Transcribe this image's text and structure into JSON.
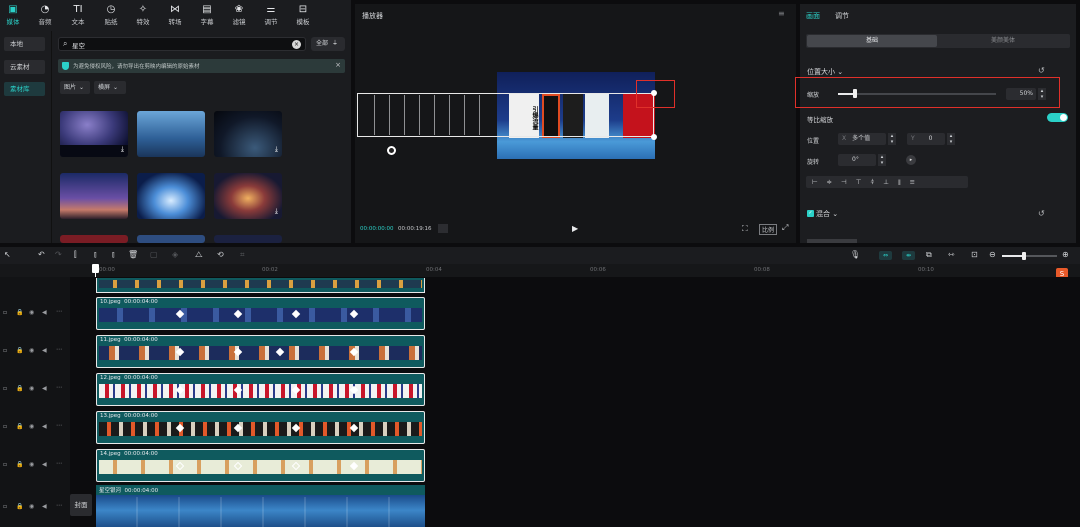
{
  "toolbar": {
    "items": [
      {
        "label": "媒体",
        "icon": "media-icon"
      },
      {
        "label": "音频",
        "icon": "audio-icon"
      },
      {
        "label": "文本",
        "icon": "text-icon"
      },
      {
        "label": "贴纸",
        "icon": "sticker-icon"
      },
      {
        "label": "特效",
        "icon": "effects-icon"
      },
      {
        "label": "转场",
        "icon": "transition-icon"
      },
      {
        "label": "字幕",
        "icon": "subtitle-icon"
      },
      {
        "label": "滤镜",
        "icon": "filter-icon"
      },
      {
        "label": "调节",
        "icon": "adjust-icon"
      },
      {
        "label": "模板",
        "icon": "template-icon"
      }
    ]
  },
  "sidebar": {
    "items": [
      {
        "label": "本地"
      },
      {
        "label": "云素材"
      },
      {
        "label": "素材库"
      }
    ]
  },
  "media": {
    "search_value": "星空",
    "filter_label": "全部",
    "notice": "为避免侵权风险，请勿导出在剪映内编辑的原始素材",
    "type_select": "图片",
    "orientation_select": "横屏"
  },
  "player": {
    "title": "播放器",
    "current_time": "00:00:00:00",
    "total_time": "00:00:19:16",
    "ratio_label": "比例",
    "book_title_1": "引爆流量"
  },
  "inspector": {
    "tabs": [
      "画面",
      "调节"
    ],
    "subtabs": [
      "基础",
      "美颜美体"
    ],
    "position_size_label": "位置大小",
    "scale_label": "缩放",
    "scale_value": "50%",
    "scale_percent": 50,
    "uniform_scale_label": "等比缩放",
    "position_label": "位置",
    "pos_x_label": "X",
    "pos_x_value": "多个值",
    "pos_y_label": "Y",
    "pos_y_value": "0",
    "rotate_label": "旋转",
    "rotate_value": "0°",
    "blend_label": "混合"
  },
  "timeline": {
    "ruler": [
      "00:00",
      "00:02",
      "00:04",
      "00:06",
      "00:08",
      "00:10"
    ],
    "cover_label": "封面",
    "clips": [
      {
        "name": "10.jpeg",
        "duration": "00:00:04:00"
      },
      {
        "name": "11.jpeg",
        "duration": "00:00:04:00"
      },
      {
        "name": "12.jpeg",
        "duration": "00:00:04:00"
      },
      {
        "name": "13.jpeg",
        "duration": "00:00:04:00"
      },
      {
        "name": "14.jpeg",
        "duration": "00:00:04:00"
      }
    ],
    "main_clip": {
      "name": "星空银河",
      "duration": "00:00:04:00"
    }
  },
  "colors": {
    "accent": "#2bd1c8",
    "highlight_box": "#e0302a",
    "clip_bg": "#0f5a5e"
  }
}
